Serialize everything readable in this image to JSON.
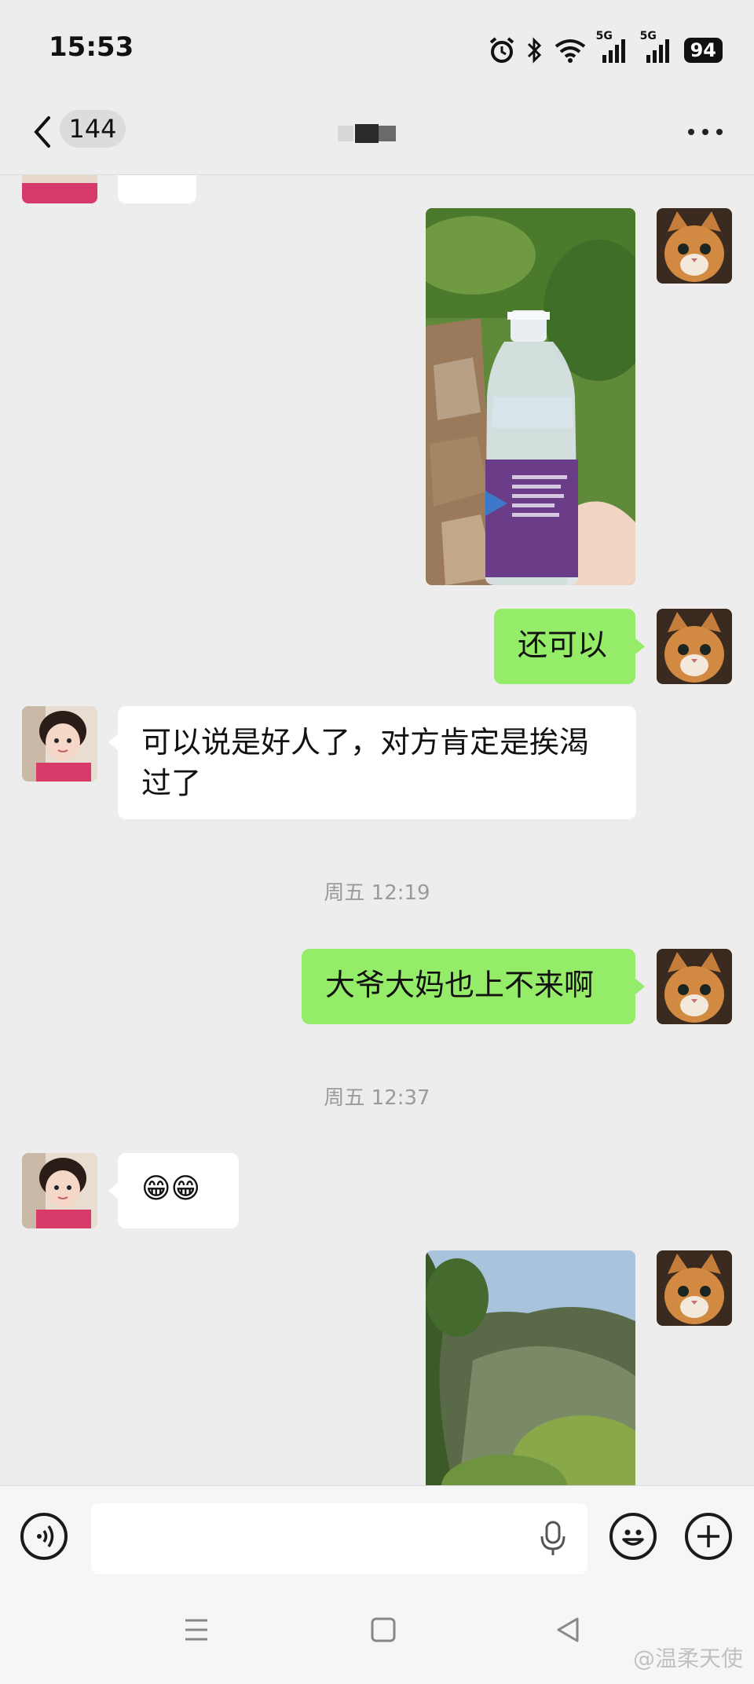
{
  "status_bar": {
    "time": "15:53",
    "battery": "94",
    "network_1": "5G",
    "network_2": "5G"
  },
  "nav": {
    "unread_count": "144"
  },
  "messages": {
    "reply_ok": "还可以",
    "friend_text_1": "可以说是好人了，对方肯定是挨渴过了",
    "ts_1": "周五 12:19",
    "reply_elderly": "大爷大妈也上不来啊",
    "ts_2": "周五 12:37",
    "friend_emoji": "😁😁"
  },
  "input": {
    "placeholder": ""
  },
  "watermark": "@温柔天使",
  "colors": {
    "background": "#ededed",
    "sent_bubble": "#95ec69",
    "received_bubble": "#ffffff"
  }
}
